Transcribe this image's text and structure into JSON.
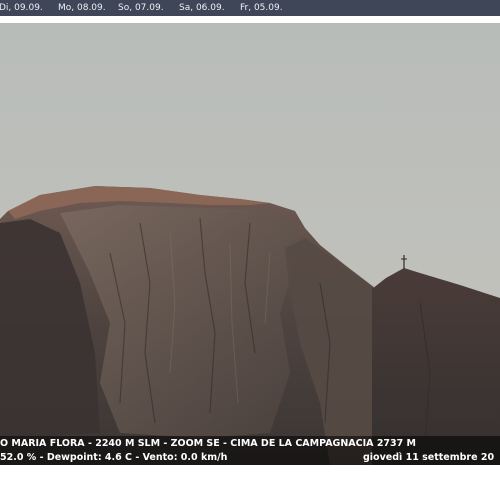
{
  "date_nav": {
    "tabs": [
      {
        "label": "Di, 09.09."
      },
      {
        "label": "Mo, 08.09."
      },
      {
        "label": "So, 07.09."
      },
      {
        "label": "Sa, 06.09."
      },
      {
        "label": "Fr, 05.09."
      }
    ]
  },
  "webcam": {
    "caption_line1": "O MARIA FLORA - 2240 M SLM - ZOOM SE - CIMA DE LA CAMPAGNACIA 2737 M",
    "caption_line2_left": "52.0 % - Dewpoint: 4.6 C - Vento: 0.0 km/h",
    "caption_line2_right": "giovedì 11 settembre 20"
  },
  "colors": {
    "nav_bar": "#3e4658",
    "sky_top": "#b9bdba",
    "sky_bottom": "#c3c3bc",
    "rock_dark": "#4a3e3a",
    "rock_mid": "#6e5f56",
    "rock_summit": "#8a6a5c"
  }
}
